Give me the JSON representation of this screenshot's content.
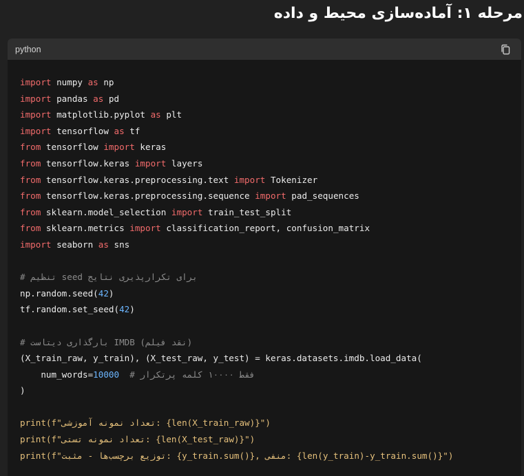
{
  "heading": "مرحله ۱: آماده‌سازی محیط و داده",
  "code_block": {
    "language": "python",
    "copy_icon": "copy-icon"
  },
  "code": {
    "imp1_kw": "import",
    "imp1_mod": " numpy ",
    "imp1_as": "as",
    "imp1_alias": " np",
    "imp2_kw": "import",
    "imp2_mod": " pandas ",
    "imp2_as": "as",
    "imp2_alias": " pd",
    "imp3_kw": "import",
    "imp3_mod": " matplotlib.pyplot ",
    "imp3_as": "as",
    "imp3_alias": " plt",
    "imp4_kw": "import",
    "imp4_mod": " tensorflow ",
    "imp4_as": "as",
    "imp4_alias": " tf",
    "from1_kw": "from",
    "from1_mod": " tensorflow ",
    "from1_imp": "import",
    "from1_name": " keras",
    "from2_kw": "from",
    "from2_mod": " tensorflow.keras ",
    "from2_imp": "import",
    "from2_name": " layers",
    "from3_kw": "from",
    "from3_mod": " tensorflow.keras.preprocessing.text ",
    "from3_imp": "import",
    "from3_name": " Tokenizer",
    "from4_kw": "from",
    "from4_mod": " tensorflow.keras.preprocessing.sequence ",
    "from4_imp": "import",
    "from4_name": " pad_sequences",
    "from5_kw": "from",
    "from5_mod": " sklearn.model_selection ",
    "from5_imp": "import",
    "from5_name": " train_test_split",
    "from6_kw": "from",
    "from6_mod": " sklearn.metrics ",
    "from6_imp": "import",
    "from6_name": " classification_report, confusion_matrix",
    "imp5_kw": "import",
    "imp5_mod": " seaborn ",
    "imp5_as": "as",
    "imp5_alias": " sns",
    "comment_seed": "# تنظیم seed برای تکرارپذیری نتایج",
    "seed1_pre": "np.random.seed(",
    "seed1_num": "42",
    "seed1_post": ")",
    "seed2_pre": "tf.random.set_seed(",
    "seed2_num": "42",
    "seed2_post": ")",
    "comment_imdb": "# بارگذاری دیتاست IMDB (نقد فیلم)",
    "load_line": "(X_train_raw, y_train), (X_test_raw, y_test) = keras.datasets.imdb.load_data(",
    "num_words_pre": "    num_words=",
    "num_words_val": "10000",
    "num_words_comment": "  # فقط ۱۰۰۰۰ کلمه پرتکرار",
    "close_paren": ")",
    "p1_print": "print",
    "p1_str": "(f\"تعداد نمونه آموزشی: {",
    "p1_len": "len",
    "p1_rest": "(X_train_raw)}\")",
    "p2_print": "print",
    "p2_str": "(f\"تعداد نمونه تستی: {",
    "p2_len": "len",
    "p2_rest": "(X_test_raw)}\")",
    "p3_print": "print",
    "p3_a": "(f\"توزیع برچسب‌ها - مثبت: {y_train.",
    "p3_sum1": "sum",
    "p3_b": "()}, منفی: {",
    "p3_len": "len",
    "p3_c": "(y_train)-y_train.",
    "p3_sum2": "sum",
    "p3_d": "()}\")"
  }
}
